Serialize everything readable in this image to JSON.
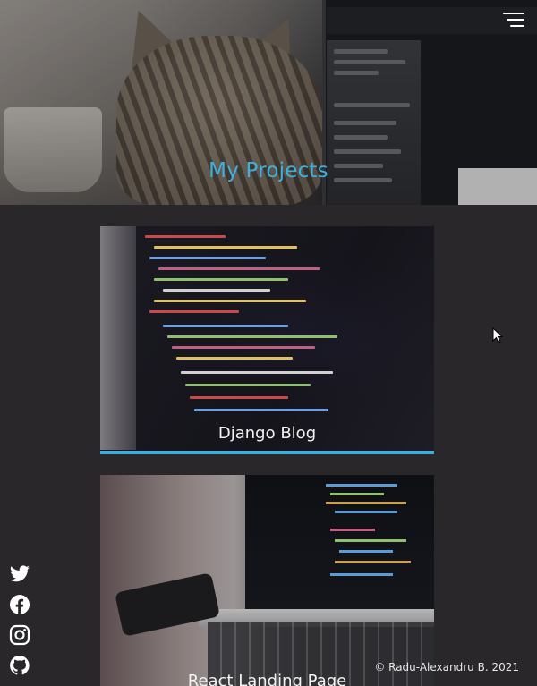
{
  "hero": {
    "title": "My Projects"
  },
  "nav": {
    "menu_icon": "hamburger-menu-icon"
  },
  "projects": [
    {
      "title": "Django Blog",
      "active": true
    },
    {
      "title": "React Landing Page",
      "active": false
    }
  ],
  "social": [
    {
      "name": "twitter",
      "icon": "twitter-icon"
    },
    {
      "name": "facebook",
      "icon": "facebook-icon"
    },
    {
      "name": "instagram",
      "icon": "instagram-icon"
    },
    {
      "name": "github",
      "icon": "github-icon"
    }
  ],
  "footer": {
    "copyright": "© Radu-Alexandru B. 2021"
  },
  "colors": {
    "background": "#29272a",
    "accent": "#3fb0de",
    "text": "#f2f2f2"
  }
}
